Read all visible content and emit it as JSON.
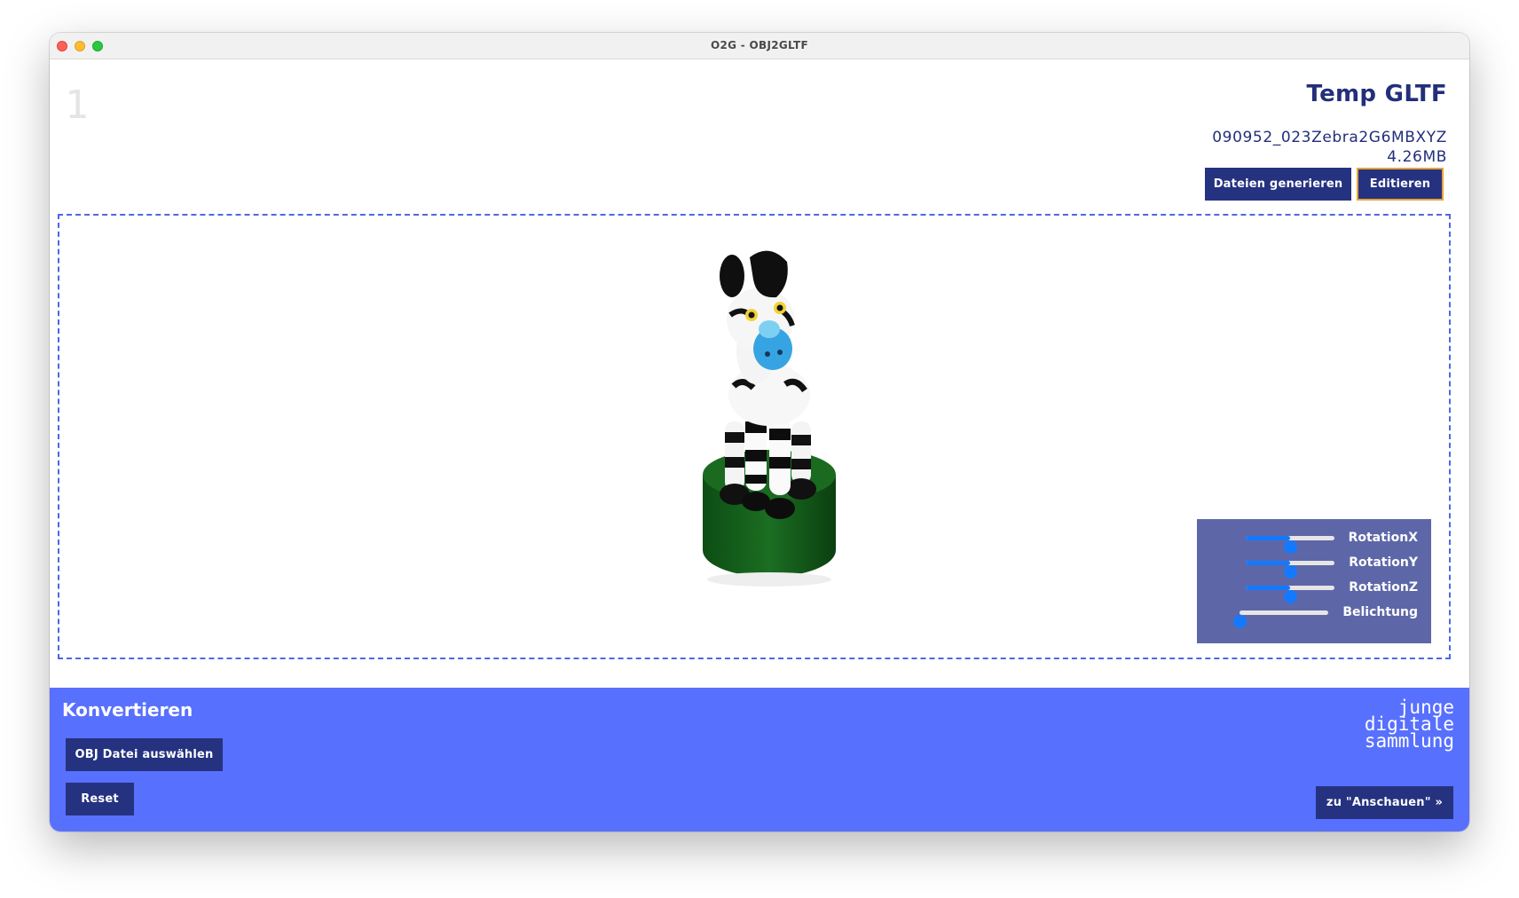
{
  "window": {
    "title": "O2G - OBJ2GLTF"
  },
  "step": {
    "number": "1"
  },
  "header": {
    "title": "Temp GLTF",
    "file_name": "090952_023Zebra2G6MBXYZ",
    "file_size": "4.26MB",
    "generate_button": "Dateien generieren",
    "edit_button": "Editieren"
  },
  "viewer": {
    "model": "zebra figure on green base",
    "controls": [
      {
        "label": "RotationX",
        "value": 0.5
      },
      {
        "label": "RotationY",
        "value": 0.5
      },
      {
        "label": "RotationZ",
        "value": 0.5
      },
      {
        "label": "Belichtung",
        "value": 0.0
      }
    ]
  },
  "footer": {
    "title": "Konvertieren",
    "select_button": "OBJ Datei auswählen",
    "reset_button": "Reset",
    "next_button": "zu \"Anschauen\" »",
    "logo_lines": [
      "junge",
      "digitale",
      "sammlung"
    ]
  },
  "colors": {
    "primary": "#253280",
    "footer": "#5870fe",
    "controls_panel": "#5d67a8",
    "slider_accent": "#1479ff",
    "edit_border": "#e6a33b"
  }
}
